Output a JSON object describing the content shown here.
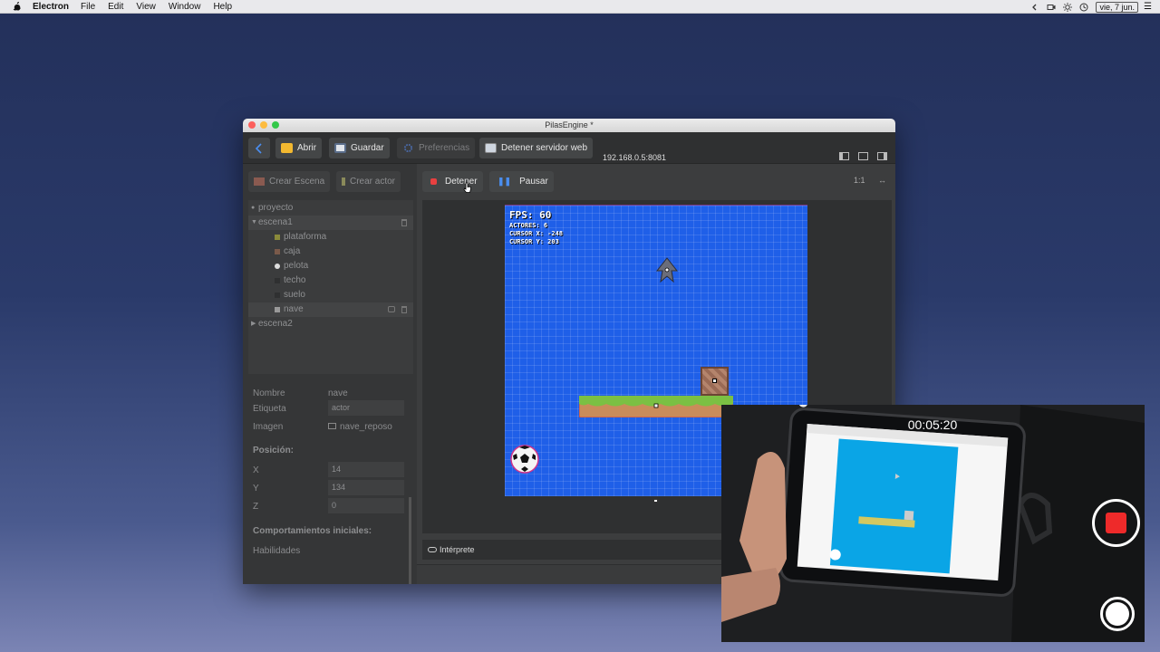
{
  "menubar": {
    "app": "Electron",
    "items": [
      "File",
      "Edit",
      "Window",
      "Help"
    ],
    "item_edit": "Edit",
    "item_view": "View",
    "date": "vie, 7 jun."
  },
  "window": {
    "title": "PilasEngine *"
  },
  "toolbar": {
    "open": "Abrir",
    "save": "Guardar",
    "prefs": "Preferencias",
    "server": "Detener servidor web",
    "ip": "192.168.0.5:8081"
  },
  "left": {
    "create_scene": "Crear Escena",
    "create_actor": "Crear actor",
    "tree": {
      "project": "proyecto",
      "scene1": "escena1",
      "actors": [
        "plataforma",
        "caja",
        "pelota",
        "techo",
        "suelo",
        "nave"
      ],
      "scene2": "escena2"
    },
    "props": {
      "name_label": "Nombre",
      "name_value": "nave",
      "tag_label": "Etiqueta",
      "tag_value": "actor",
      "image_label": "Imagen",
      "image_value": "nave_reposo",
      "position_title": "Posición:",
      "x_label": "X",
      "x_value": "14",
      "y_label": "Y",
      "y_value": "134",
      "z_label": "Z",
      "z_value": "0",
      "behaviors_title": "Comportamientos iniciales:",
      "skills_label": "Habilidades"
    }
  },
  "main": {
    "stop": "Detener",
    "pause": "Pausar",
    "ratio": "1:1",
    "expand": "↔",
    "console": "Intérprete"
  },
  "game": {
    "fps": "FPS: 60",
    "actors": "ACTORES: 6",
    "cursor_x": "CURSOR X: -248",
    "cursor_y": "CURSOR Y: 203"
  },
  "overlay": {
    "timer": "00:05:20"
  },
  "colors": {
    "game_bg": "#1f5fe8",
    "record": "#ee2a2a",
    "stop_icon": "#e84040",
    "pause_icon": "#4a8ef0"
  }
}
